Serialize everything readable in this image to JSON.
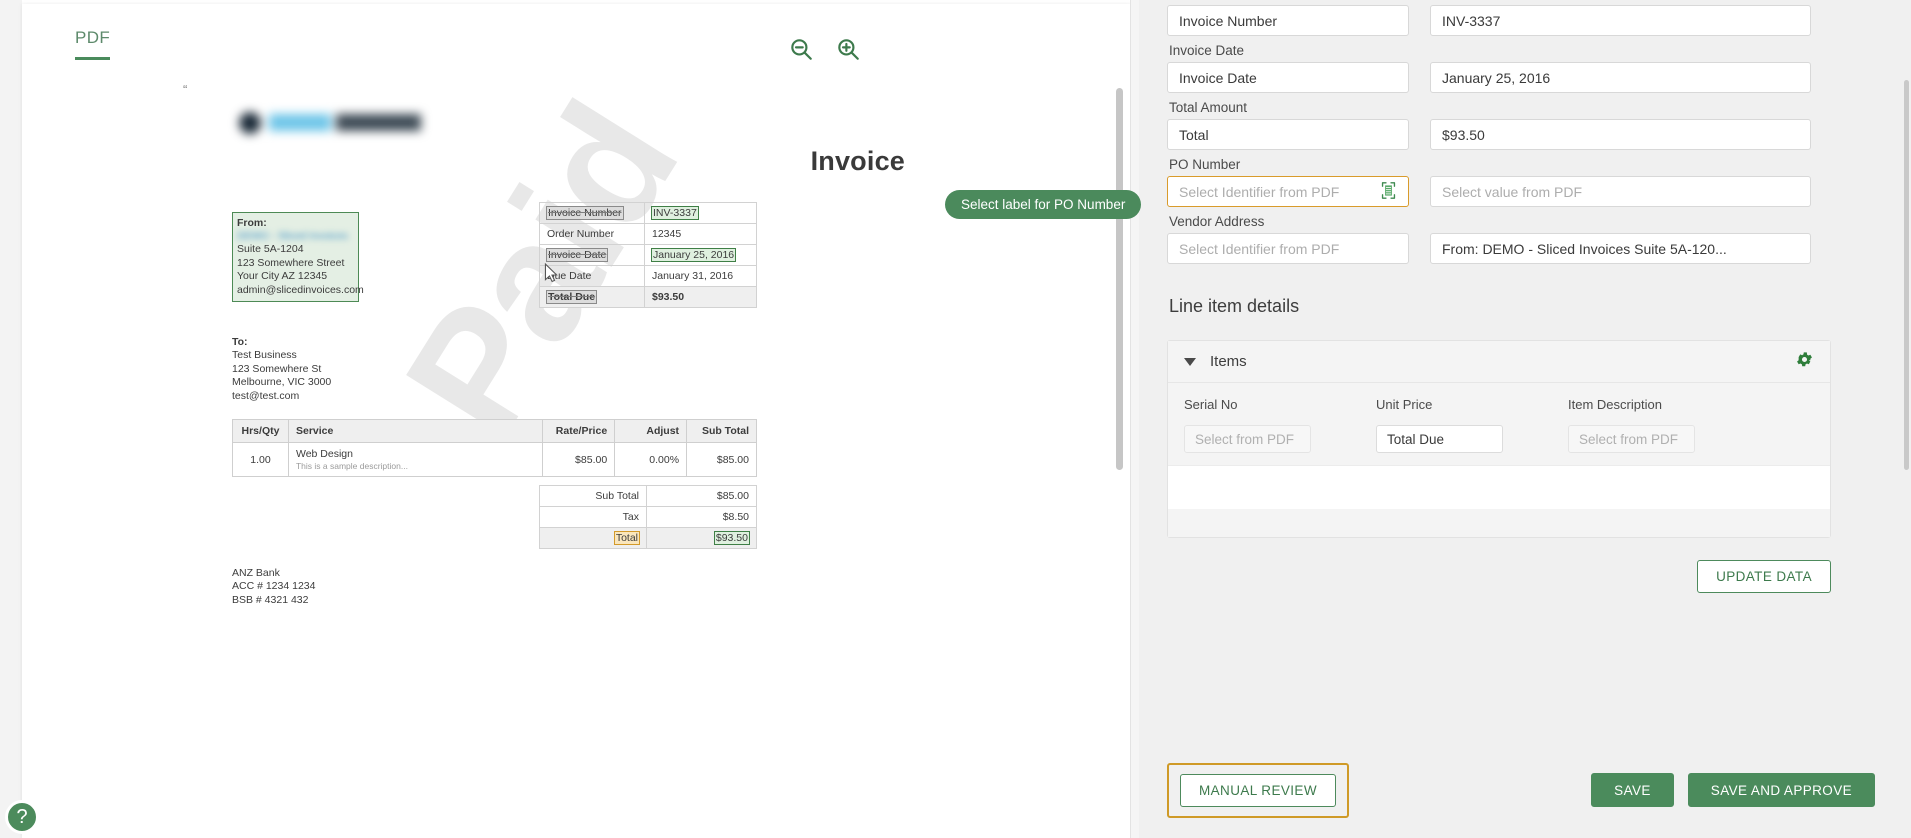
{
  "pdf_viewer": {
    "tab_label": "PDF",
    "zoom_out_icon": "zoom-out-icon",
    "zoom_in_icon": "zoom-in-icon",
    "quote_mark": "“",
    "watermark": "Paid"
  },
  "invoice_document": {
    "title": "Invoice",
    "from": {
      "heading": "From:",
      "company": "DEMO - Sliced Invoices",
      "lines": [
        "Suite 5A-1204",
        "123 Somewhere Street",
        "Your City AZ 12345",
        "admin@slicedinvoices.com"
      ]
    },
    "to": {
      "heading": "To:",
      "lines": [
        "Test Business",
        "123 Somewhere St",
        "Melbourne, VIC 3000",
        "test@test.com"
      ]
    },
    "summary": [
      {
        "key": "Invoice Number",
        "value": "INV-3337",
        "key_highlight": "grey",
        "value_highlight": "green"
      },
      {
        "key": "Order Number",
        "value": "12345",
        "key_highlight": "none",
        "value_highlight": "none"
      },
      {
        "key": "Invoice Date",
        "value": "January 25, 2016",
        "key_highlight": "grey",
        "value_highlight": "green"
      },
      {
        "key": "Due Date",
        "value": "January 31, 2016",
        "key_highlight": "none",
        "value_highlight": "none"
      },
      {
        "key": "Total Due",
        "value": "$93.50",
        "key_highlight": "grey",
        "value_highlight": "none"
      }
    ],
    "line_items": {
      "headers": [
        "Hrs/Qty",
        "Service",
        "Rate/Price",
        "Adjust",
        "Sub Total"
      ],
      "rows": [
        {
          "qty": "1.00",
          "service": "Web Design",
          "description": "This is a sample description...",
          "rate": "$85.00",
          "adjust": "0.00%",
          "sub_total": "$85.00"
        }
      ]
    },
    "totals": [
      {
        "key": "Sub Total",
        "value": "$85.00",
        "key_highlight": "none",
        "value_highlight": "none"
      },
      {
        "key": "Tax",
        "value": "$8.50",
        "key_highlight": "none",
        "value_highlight": "none"
      },
      {
        "key": "Total",
        "value": "$93.50",
        "key_highlight": "amber",
        "value_highlight": "green"
      }
    ],
    "bank": [
      "ANZ Bank",
      "ACC # 1234 1234",
      "BSB # 4321 432"
    ]
  },
  "tooltip": {
    "text": "Select label for PO Number"
  },
  "help_button": {
    "glyph": "?"
  },
  "form": {
    "fields": [
      {
        "label": "",
        "identifier_value": "Invoice Number",
        "identifier_placeholder": "Select Identifier from PDF",
        "value": "INV-3337",
        "value_placeholder": "Select value from PDF",
        "focused": false,
        "has_scan_icon": false
      },
      {
        "label": "Invoice Date",
        "identifier_value": "Invoice Date",
        "identifier_placeholder": "Select Identifier from PDF",
        "value": "January 25, 2016",
        "value_placeholder": "Select value from PDF",
        "focused": false,
        "has_scan_icon": false
      },
      {
        "label": "Total Amount",
        "identifier_value": "Total",
        "identifier_placeholder": "Select Identifier from PDF",
        "value": "$93.50",
        "value_placeholder": "Select value from PDF",
        "focused": false,
        "has_scan_icon": false
      },
      {
        "label": "PO Number",
        "identifier_value": "",
        "identifier_placeholder": "Select Identifier from PDF",
        "value": "",
        "value_placeholder": "Select value from PDF",
        "focused": true,
        "has_scan_icon": true
      },
      {
        "label": "Vendor Address",
        "identifier_value": "",
        "identifier_placeholder": "Select Identifier from PDF",
        "value": "From: DEMO - Sliced Invoices Suite 5A-120...",
        "value_placeholder": "Select value from PDF",
        "focused": false,
        "has_scan_icon": false
      }
    ],
    "line_item_section": {
      "title": "Line item details",
      "group_label": "Items",
      "gear_icon": "gear-icon",
      "caret_icon": "caret-down-icon",
      "columns": [
        {
          "header": "Serial No",
          "value": "",
          "placeholder": "Select from PDF"
        },
        {
          "header": "Unit Price",
          "value": "Total Due",
          "placeholder": "Select from PDF"
        },
        {
          "header": "Item Description",
          "value": "",
          "placeholder": "Select from PDF"
        }
      ]
    },
    "buttons": {
      "update_data": "UPDATE DATA",
      "manual_review": "MANUAL REVIEW",
      "save": "SAVE",
      "save_and_approve": "SAVE AND APPROVE"
    }
  },
  "colors": {
    "brand_green": "#4b8b5c",
    "focus_amber": "#cf9a27",
    "panel_bg": "#f0f0f0"
  }
}
